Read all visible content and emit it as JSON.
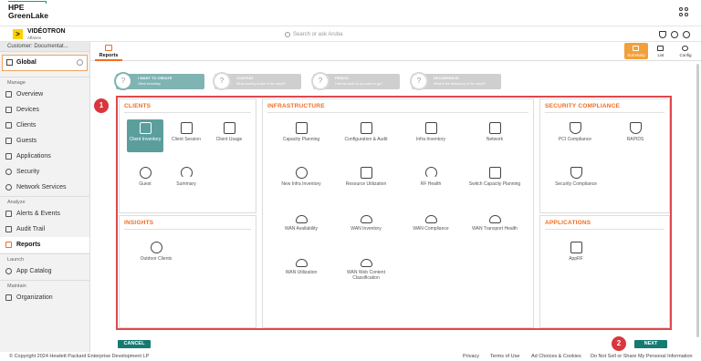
{
  "brand": {
    "line1": "HPE",
    "line2": "GreenLake"
  },
  "org": {
    "name": "VIDÉOTRON",
    "sub": "Affaires",
    "mark": ">"
  },
  "search": {
    "placeholder": "Search or ask Aruba"
  },
  "sidebar": {
    "customer": "Customer: Documentat...",
    "global": "Global",
    "sections": [
      {
        "title": "Manage",
        "items": [
          "Overview",
          "Devices",
          "Clients",
          "Guests",
          "Applications",
          "Security",
          "Network Services"
        ]
      },
      {
        "title": "Analyze",
        "items": [
          "Alerts & Events",
          "Audit Trail",
          "Reports"
        ]
      },
      {
        "title": "Launch",
        "items": [
          "App Catalog"
        ]
      },
      {
        "title": "Maintain",
        "items": [
          "Organization"
        ]
      }
    ]
  },
  "tabs": {
    "reports": "Reports",
    "summary": "Summary",
    "list": "List",
    "config": "Config"
  },
  "steps": [
    {
      "title": "I WANT TO CREATE",
      "sub": "Client Inventory",
      "mark": "?"
    },
    {
      "title": "CONTENT",
      "sub": "What would you like in the report?",
      "mark": "?"
    },
    {
      "title": "PERIOD",
      "sub": "How far back do you want to go?",
      "mark": "?"
    },
    {
      "title": "RECURRENCE",
      "sub": "What is the frequency of the report?",
      "mark": "?"
    }
  ],
  "callouts": {
    "one": "1",
    "two": "2"
  },
  "panels": {
    "clients": {
      "title": "CLIENTS",
      "tiles": [
        "Client Inventory",
        "Client Session",
        "Client Usage",
        "Guest",
        "Summary"
      ]
    },
    "insights": {
      "title": "INSIGHTS",
      "tiles": [
        "Outdoor Clients"
      ]
    },
    "infrastructure": {
      "title": "INFRASTRUCTURE",
      "tiles": [
        "Capacity Planning",
        "Configuration & Audit",
        "Infra Inventory",
        "Network",
        "New Infra Inventory",
        "Resource Utilization",
        "RF Health",
        "Switch Capacity Planning",
        "WAN Availability",
        "WAN Inventory",
        "WAN Compliance",
        "WAN Transport Health",
        "WAN Utilization",
        "WAN Web Content Classification"
      ]
    },
    "security": {
      "title": "SECURITY COMPLIANCE",
      "tiles": [
        "PCI Compliance",
        "RAPIDS",
        "Security Compliance"
      ]
    },
    "applications": {
      "title": "APPLICATIONS",
      "tiles": [
        "AppRF"
      ]
    }
  },
  "buttons": {
    "cancel": "CANCEL",
    "next": "NEXT"
  },
  "footer": {
    "copyright": "© Copyright 2024 Hewlett Packard Enterprise Development LP",
    "links": [
      "Privacy",
      "Terms of Use",
      "Ad Choices & Cookies",
      "Do Not Sell or Share My Personal Information"
    ]
  },
  "colors": {
    "accent": "#f26c21",
    "teal": "#147a72",
    "highlight": "#e0474c",
    "selected_tile": "#5b9e9c"
  }
}
